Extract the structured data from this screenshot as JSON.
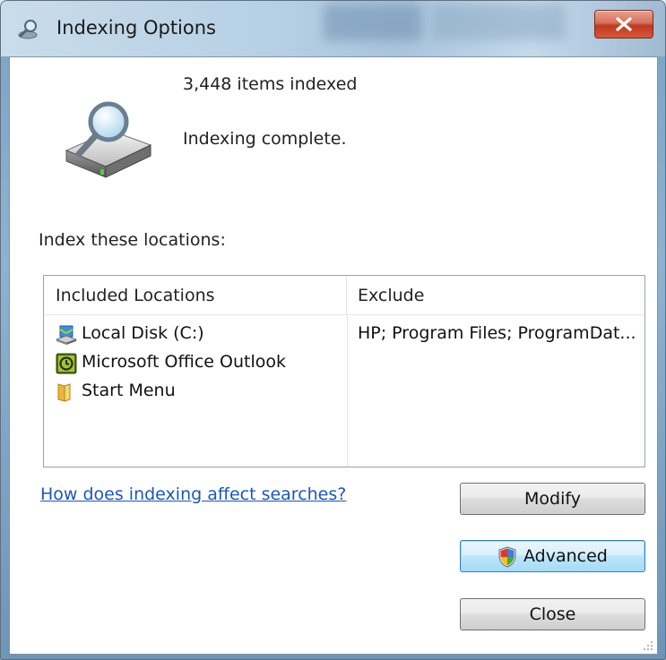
{
  "window": {
    "title": "Indexing Options",
    "close_label": "X"
  },
  "status": {
    "items_indexed": "3,448 items indexed",
    "state": "Indexing complete."
  },
  "locations": {
    "section_label": "Index these locations:",
    "columns": {
      "included": "Included Locations",
      "exclude": "Exclude"
    },
    "rows": [
      {
        "name": "Local Disk (C:)",
        "exclude": "HP; Program Files; ProgramDat...",
        "icon": "local-disk-icon"
      },
      {
        "name": "Microsoft Office Outlook",
        "exclude": "",
        "icon": "outlook-icon"
      },
      {
        "name": "Start Menu",
        "exclude": "",
        "icon": "folder-icon"
      }
    ]
  },
  "help_link": "How does indexing affect searches?",
  "buttons": {
    "modify": "Modify",
    "advanced": "Advanced",
    "close": "Close"
  },
  "colors": {
    "link": "#1c57b6",
    "close_button": "#c0391f",
    "advanced_highlight": "#bee6fd"
  }
}
